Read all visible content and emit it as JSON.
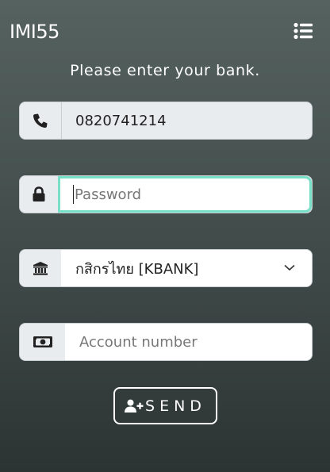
{
  "header": {
    "brand": "IMI55",
    "menu_icon": "list-icon"
  },
  "form": {
    "subtitle": "Please enter your bank.",
    "phone": {
      "icon": "phone-icon",
      "value": "0820741214"
    },
    "password": {
      "icon": "lock-icon",
      "placeholder": "Password",
      "value": ""
    },
    "bank": {
      "icon": "bank-icon",
      "selected": "กสิกรไทย [KBANK]"
    },
    "account": {
      "icon": "money-bill-icon",
      "placeholder": "Account number",
      "value": ""
    },
    "send_label": "SEND",
    "send_icon": "user-plus-icon"
  },
  "colors": {
    "focus_border": "#79e0c8",
    "field_bg": "#e9ecef"
  }
}
